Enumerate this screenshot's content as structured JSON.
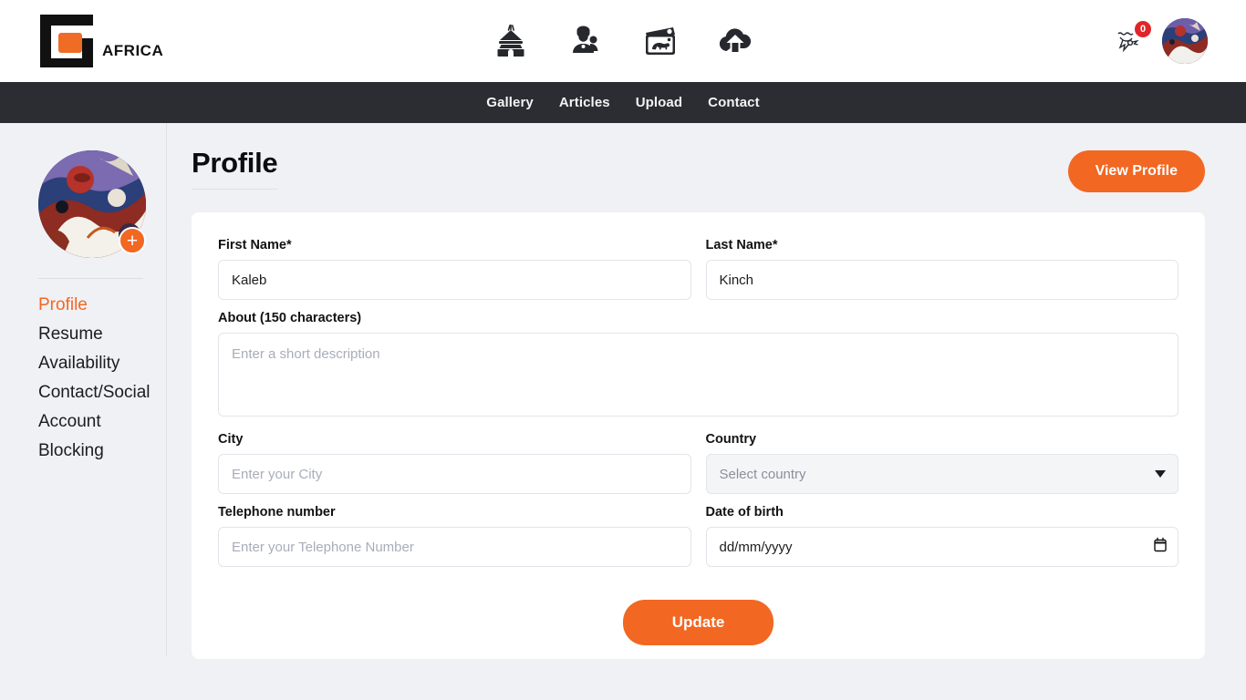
{
  "brand": {
    "name": "AFRICA",
    "logo_colors": {
      "dark": "#111111",
      "accent": "#ef6c26"
    }
  },
  "header": {
    "icons": [
      {
        "name": "hut-icon",
        "label": "Home"
      },
      {
        "name": "community-icon",
        "label": "Community"
      },
      {
        "name": "gallery-photo-icon",
        "label": "Gallery"
      },
      {
        "name": "cloud-upload-icon",
        "label": "Upload"
      }
    ],
    "notifications": {
      "icon": "notification-icon",
      "count": "0",
      "badge_color": "#e0252a"
    },
    "avatar": {
      "name": "user-avatar",
      "alt": "User profile picture"
    }
  },
  "navbar": {
    "items": [
      {
        "label": "Gallery"
      },
      {
        "label": "Articles"
      },
      {
        "label": "Upload"
      },
      {
        "label": "Contact"
      }
    ]
  },
  "sidebar": {
    "avatar": {
      "name": "profile-avatar",
      "add_badge": "+"
    },
    "items": [
      {
        "label": "Profile",
        "active": true
      },
      {
        "label": "Resume",
        "active": false
      },
      {
        "label": "Availability",
        "active": false
      },
      {
        "label": "Contact/Social",
        "active": false
      },
      {
        "label": "Account",
        "active": false
      },
      {
        "label": "Blocking",
        "active": false
      }
    ]
  },
  "main": {
    "title": "Profile",
    "view_profile_label": "View Profile",
    "form": {
      "first_name": {
        "label": "First Name*",
        "value": "Kaleb",
        "placeholder": ""
      },
      "last_name": {
        "label": "Last Name*",
        "value": "Kinch",
        "placeholder": ""
      },
      "about": {
        "label": "About (150 characters)",
        "value": "",
        "placeholder": "Enter a short description"
      },
      "city": {
        "label": "City",
        "value": "",
        "placeholder": "Enter your City"
      },
      "country": {
        "label": "Country",
        "value": "Select country",
        "placeholder": "Select country"
      },
      "telephone": {
        "label": "Telephone number",
        "value": "",
        "placeholder": "Enter your Telephone Number"
      },
      "dob": {
        "label": "Date of birth",
        "value": "dd/mm/yyyy",
        "placeholder": "dd/mm/yyyy"
      }
    },
    "submit_label": "Update"
  },
  "colors": {
    "accent": "#f26722",
    "navbar_bg": "#2b2d33",
    "page_bg": "#f0f1f5",
    "card_bg": "#ffffff",
    "badge_red": "#e0252a"
  }
}
